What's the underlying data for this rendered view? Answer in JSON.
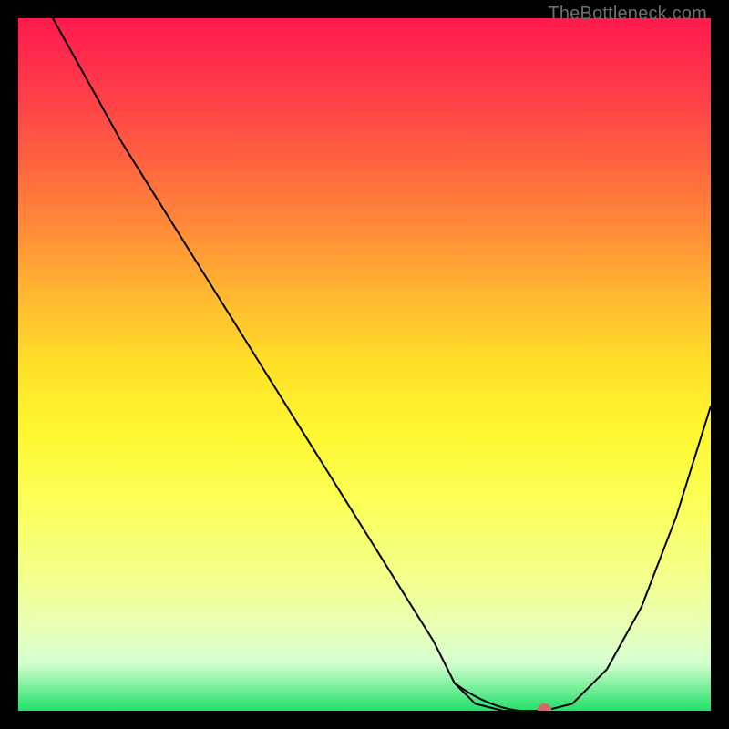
{
  "watermark": "TheBottleneck.com",
  "chart_data": {
    "type": "line",
    "title": "",
    "xlabel": "",
    "ylabel": "",
    "xlim": [
      0,
      100
    ],
    "ylim": [
      0,
      100
    ],
    "grid": false,
    "x": [
      5,
      10,
      15,
      20,
      25,
      30,
      35,
      40,
      45,
      50,
      55,
      60,
      63,
      66,
      70,
      73,
      76,
      80,
      85,
      90,
      95,
      100
    ],
    "values": [
      100,
      91,
      82,
      74,
      66,
      58,
      50,
      42,
      34,
      26,
      18,
      10,
      4,
      1,
      0,
      0,
      0,
      1,
      6,
      15,
      28,
      44
    ],
    "trough_x": [
      63,
      76
    ],
    "trough_dot_x": 76,
    "colors": {
      "curve": "#000000",
      "trough": "#d26a6a",
      "gradient_top": "#ff1a4d",
      "gradient_bottom": "#22e06a"
    },
    "annotations": []
  }
}
